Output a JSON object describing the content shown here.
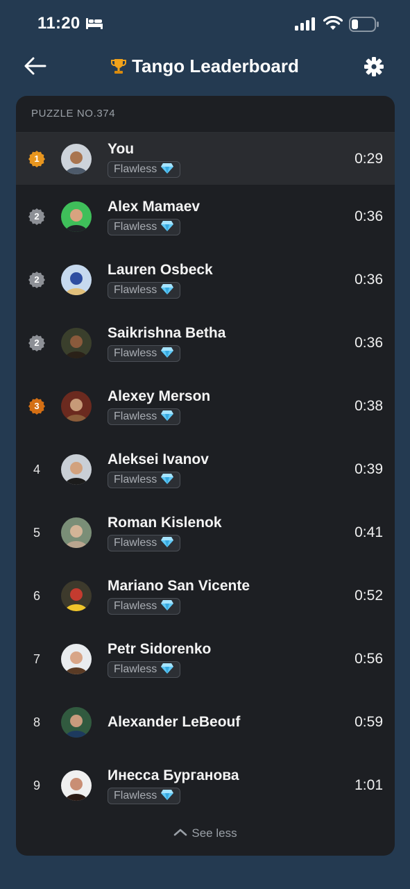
{
  "status_bar": {
    "time": "11:20"
  },
  "header": {
    "title": "Tango Leaderboard"
  },
  "puzzle_label": "PUZZLE NO.374",
  "colors": {
    "gold": "#e8961f",
    "silver": "#8d9096",
    "bronze": "#d46f14",
    "background": "#243a51",
    "card": "#1d1f23"
  },
  "entries": [
    {
      "rank": "1",
      "medal": "gold",
      "name": "You",
      "badge": "Flawless",
      "time": "0:29"
    },
    {
      "rank": "2",
      "medal": "silver",
      "name": "Alex Mamaev",
      "badge": "Flawless",
      "time": "0:36"
    },
    {
      "rank": "2",
      "medal": "silver",
      "name": "Lauren Osbeck",
      "badge": "Flawless",
      "time": "0:36"
    },
    {
      "rank": "2",
      "medal": "silver",
      "name": "Saikrishna Betha",
      "badge": "Flawless",
      "time": "0:36"
    },
    {
      "rank": "3",
      "medal": "bronze",
      "name": "Alexey Merson",
      "badge": "Flawless",
      "time": "0:38"
    },
    {
      "rank": "4",
      "name": "Aleksei Ivanov",
      "badge": "Flawless",
      "time": "0:39"
    },
    {
      "rank": "5",
      "name": "Roman Kislenok",
      "badge": "Flawless",
      "time": "0:41"
    },
    {
      "rank": "6",
      "name": "Mariano San Vicente",
      "badge": "Flawless",
      "time": "0:52"
    },
    {
      "rank": "7",
      "name": "Petr Sidorenko",
      "badge": "Flawless",
      "time": "0:56"
    },
    {
      "rank": "8",
      "name": "Alexander LeBeouf",
      "badge": "",
      "time": "0:59"
    },
    {
      "rank": "9",
      "name": "Инесса Бурганова",
      "badge": "Flawless",
      "time": "1:01"
    }
  ],
  "footer": {
    "see_less_label": "See less"
  }
}
